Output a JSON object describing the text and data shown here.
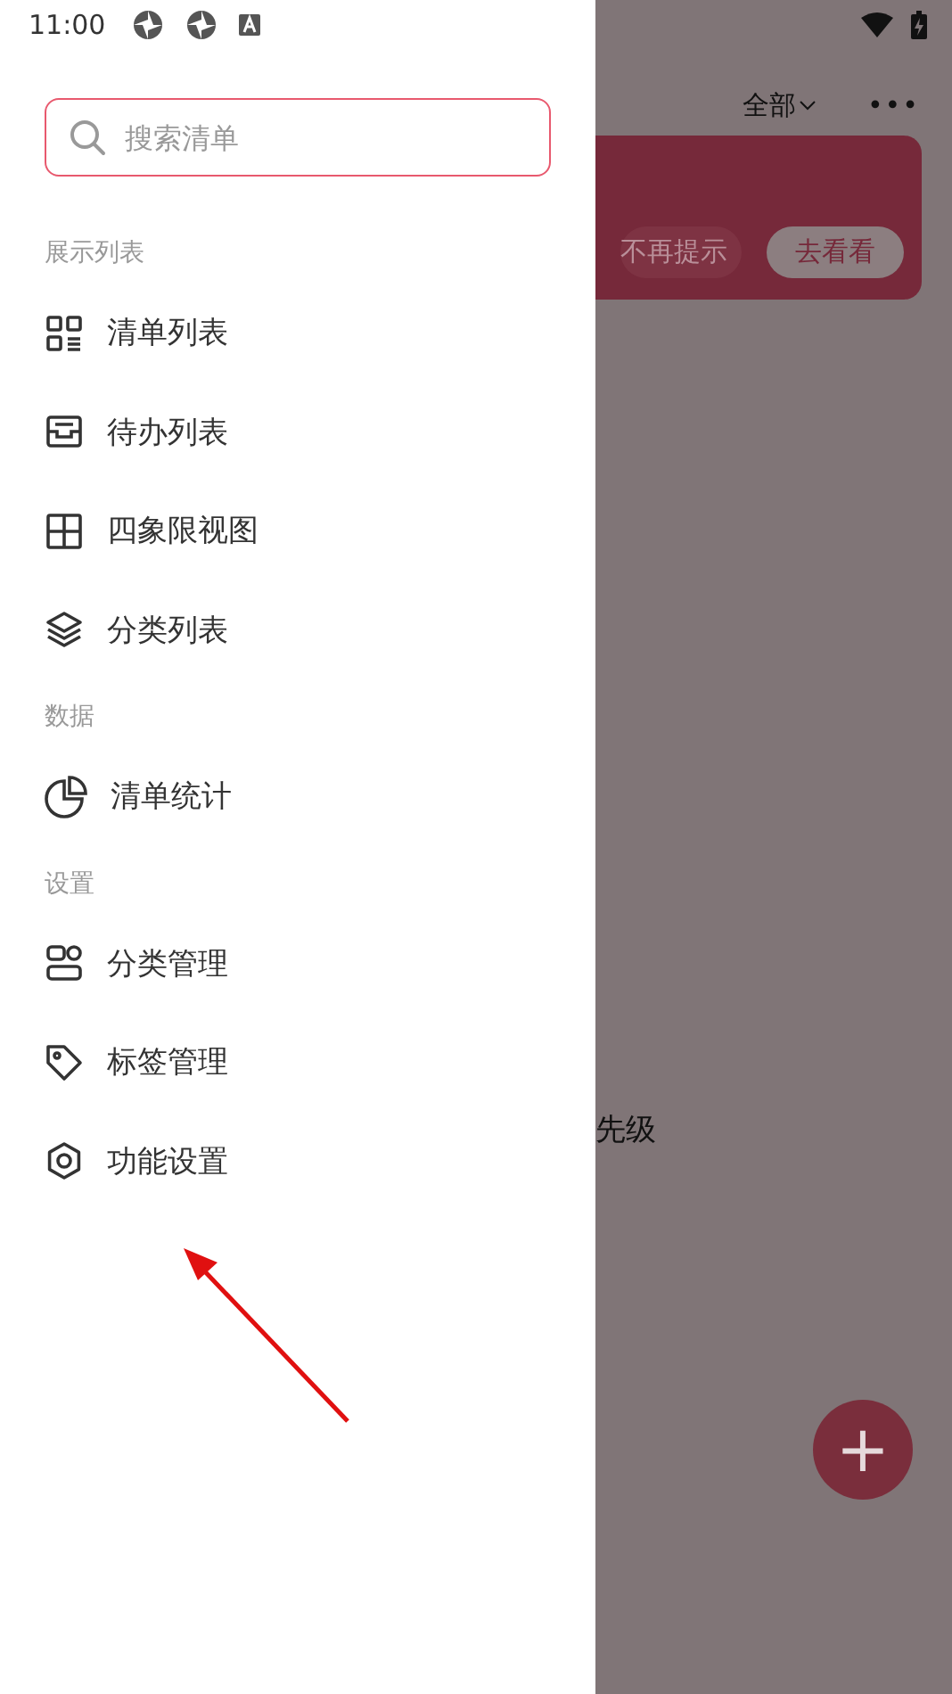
{
  "status_bar": {
    "time": "11:00"
  },
  "drawer": {
    "search": {
      "placeholder": "搜索清单"
    },
    "sections": [
      {
        "title": "展示列表",
        "items": [
          {
            "label": "清单列表",
            "kind": "grid"
          },
          {
            "label": "待办列表",
            "kind": "inbox"
          },
          {
            "label": "四象限视图",
            "kind": "quadrant"
          },
          {
            "label": "分类列表",
            "kind": "layers"
          }
        ]
      },
      {
        "title": "数据",
        "items": [
          {
            "label": "清单统计",
            "kind": "pie"
          }
        ]
      },
      {
        "title": "设置",
        "items": [
          {
            "label": "分类管理",
            "kind": "category"
          },
          {
            "label": "标签管理",
            "kind": "tag"
          },
          {
            "label": "功能设置",
            "kind": "gear"
          }
        ]
      }
    ]
  },
  "background": {
    "filter": "全部",
    "more": "•••",
    "banner_buttons": [
      "不再提示",
      "去看看"
    ],
    "card_text": "先级",
    "fab": "+"
  }
}
